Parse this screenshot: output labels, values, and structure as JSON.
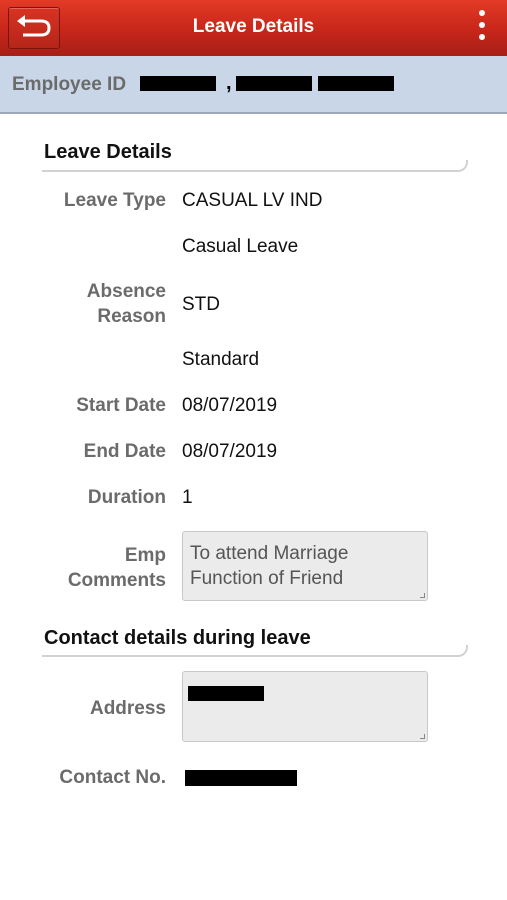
{
  "header": {
    "title": "Leave Details",
    "back_icon": "back-arrow-icon",
    "menu_icon": "overflow-menu-icon"
  },
  "employee": {
    "label": "Employee ID",
    "separator": ","
  },
  "leave_section": {
    "title": "Leave Details",
    "leave_type_label": "Leave Type",
    "leave_type_code": "CASUAL LV IND",
    "leave_type_desc": "Casual Leave",
    "absence_reason_label_1": "Absence",
    "absence_reason_label_2": "Reason",
    "absence_reason_code": "STD",
    "absence_reason_desc": "Standard",
    "start_date_label": "Start Date",
    "start_date": "08/07/2019",
    "end_date_label": "End Date",
    "end_date": "08/07/2019",
    "duration_label": "Duration",
    "duration": "1",
    "comments_label_1": "Emp",
    "comments_label_2": "Comments",
    "comments": "To attend Marriage Function of Friend"
  },
  "contact_section": {
    "title": "Contact details during leave",
    "address_label": "Address",
    "contact_label": "Contact No."
  },
  "colors": {
    "header_red": "#c7261a",
    "employee_strip": "#c8d6e8"
  }
}
